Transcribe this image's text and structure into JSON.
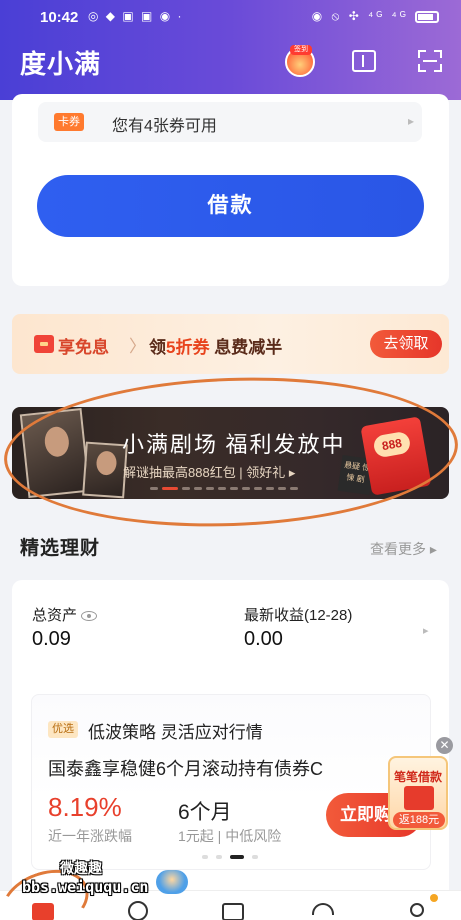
{
  "status_bar": {
    "time": "10:42",
    "left_icons": "◎ ◆ ▣ ▣ ◉ ·",
    "right_icons": "◉ ⦸ ✣ ⁴ᴳ ⁴ᴳ"
  },
  "header": {
    "title": "度小满",
    "signin_tag": "签到"
  },
  "loan_card": {
    "coupon_tag": "卡券",
    "coupon_text": "您有4张券可用",
    "borrow_label": "借款"
  },
  "promo": {
    "left_text": "享免息",
    "separator": "〉",
    "prefix": "领",
    "highlight": "5折券",
    "suffix": "息费减半",
    "button_label": "去领取"
  },
  "banner": {
    "title": "小满剧场 福利发放中",
    "subtitle": "解谜抽最高888红包 | 领好礼 ▸",
    "red_pack_amount": "888",
    "box_label": "悬疑 惊悚 剧",
    "dots_total": 12,
    "dots_active_index": 1
  },
  "finance_section": {
    "title": "精选理财",
    "more_label": "查看更多 ▸"
  },
  "finance_card": {
    "asset_label": "总资产",
    "asset_value": "0.09",
    "earnings_label": "最新收益(12-28)",
    "earnings_value": "0.00",
    "product": {
      "tag": "优选",
      "tagline": "低波策略 灵活应对行情",
      "name": "国泰鑫享稳健6个月滚动持有债券C",
      "rate": "8.19%",
      "rate_label": "近一年涨跌幅",
      "term": "6个月",
      "term_label": "1元起 | 中低风险",
      "buy_label": "立即购买"
    },
    "dots_total": 4,
    "dots_active_index": 2
  },
  "float_ad": {
    "title": "笔笔借款",
    "bottom": "返188元",
    "close": "✕"
  },
  "watermark": {
    "top": "微趣趣",
    "url": "bbs.weiququ.cn"
  },
  "colors": {
    "brand_blue": "#2f5ff0",
    "accent_red": "#e8402c",
    "header_purple": "#5a45d8"
  }
}
